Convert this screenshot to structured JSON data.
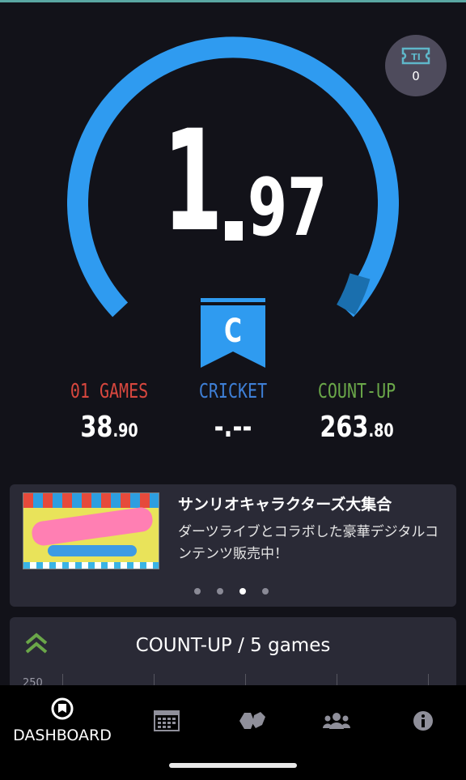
{
  "rating": {
    "integer": "1",
    "fraction": "97",
    "gauge_fraction": 0.85
  },
  "ticket": {
    "icon": "ticket-icon",
    "count": "0"
  },
  "flag": {
    "letter": "C",
    "color": "#2f9bf0"
  },
  "stats": [
    {
      "label": "01 GAMES",
      "value_int": "38",
      "value_dec": ".90",
      "color": "#d8473e"
    },
    {
      "label": "CRICKET",
      "value_int": "-.--",
      "value_dec": "",
      "color": "#3e7fd6"
    },
    {
      "label": "COUNT-UP",
      "value_int": "263",
      "value_dec": ".80",
      "color": "#6aa749"
    }
  ],
  "news": {
    "title": "サンリオキャラクターズ大集合",
    "body": "ダーツライブとコラボした豪華デジタルコンテンツ販売中！",
    "banner_alt": "サンリオキャラクターズ デジタルコンテンツ販売",
    "dots": 4,
    "active_dot": 2
  },
  "countup": {
    "title": "COUNT-UP / 5 games",
    "axis_label": "250",
    "icon": "double-chevron-up-icon"
  },
  "nav": {
    "items": [
      {
        "name": "dashboard",
        "label": "DASHBOARD",
        "icon": "dashboard-icon"
      },
      {
        "name": "calendar",
        "label": "",
        "icon": "calendar-icon"
      },
      {
        "name": "games",
        "label": "",
        "icon": "dart-games-icon"
      },
      {
        "name": "friends",
        "label": "",
        "icon": "friends-icon"
      },
      {
        "name": "info",
        "label": "",
        "icon": "info-icon"
      }
    ]
  },
  "colors": {
    "gauge": "#2f9bf0",
    "gauge_end": "#1a6fae",
    "background": "#121219",
    "card": "#2a2a36"
  }
}
